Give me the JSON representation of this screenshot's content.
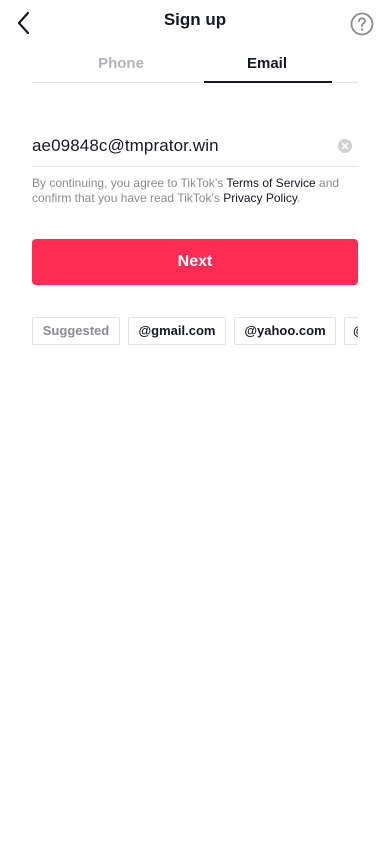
{
  "header": {
    "title": "Sign up",
    "back_icon": "chevron-left-icon",
    "help_icon": "question-circle-icon"
  },
  "tabs": [
    {
      "label": "Phone",
      "active": false
    },
    {
      "label": "Email",
      "active": true
    }
  ],
  "email_input": {
    "value": "ae09848c@tmprator.win",
    "clear_icon": "clear-icon"
  },
  "terms": {
    "prefix": "By continuing, you agree to TikTok’s ",
    "terms_link": "Terms of Service",
    "middle": " and confirm that you have read TikTok’s ",
    "privacy_link": "Privacy Policy",
    "suffix": "."
  },
  "next_button": {
    "label": "Next"
  },
  "suggestions": {
    "label": "Suggested",
    "items": [
      "@gmail.com",
      "@yahoo.com",
      "@"
    ]
  },
  "colors": {
    "accent": "#fe2c55",
    "text_primary": "#161823",
    "text_secondary": "#8a8b91",
    "divider": "#e3e3e4"
  }
}
